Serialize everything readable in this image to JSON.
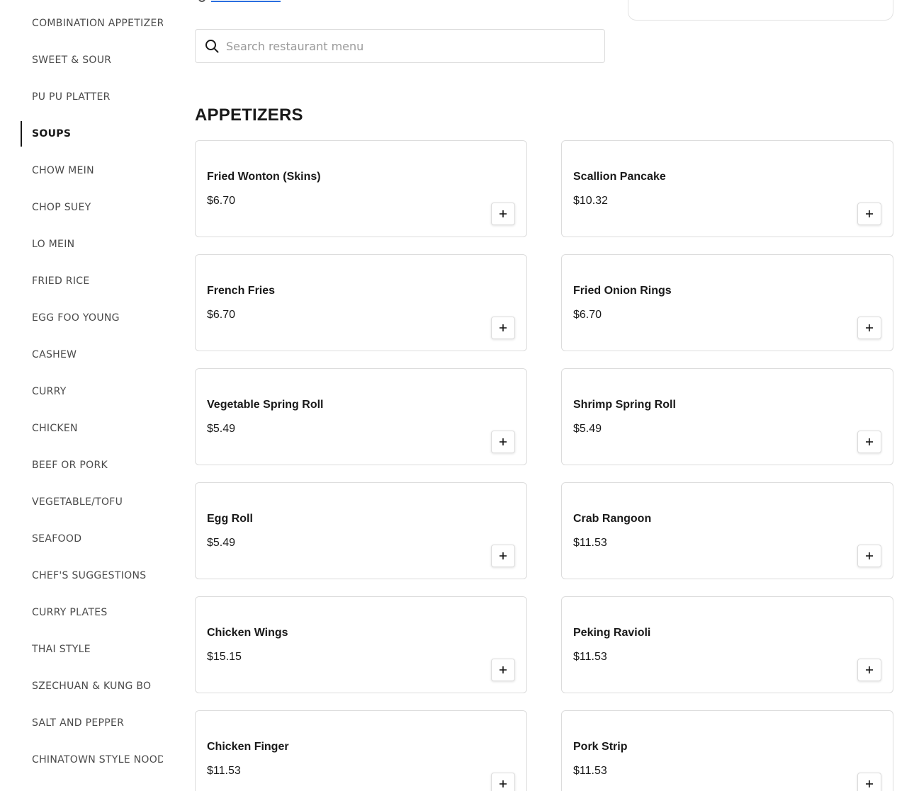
{
  "sidebar": {
    "categories": [
      {
        "label": "COMBINATION APPETIZERS",
        "active": false
      },
      {
        "label": "SWEET & SOUR",
        "active": false
      },
      {
        "label": "PU PU PLATTER",
        "active": false
      },
      {
        "label": "SOUPS",
        "active": true
      },
      {
        "label": "CHOW MEIN",
        "active": false
      },
      {
        "label": "CHOP SUEY",
        "active": false
      },
      {
        "label": "LO MEIN",
        "active": false
      },
      {
        "label": "FRIED RICE",
        "active": false
      },
      {
        "label": "EGG FOO YOUNG",
        "active": false
      },
      {
        "label": "CASHEW",
        "active": false
      },
      {
        "label": "CURRY",
        "active": false
      },
      {
        "label": "CHICKEN",
        "active": false
      },
      {
        "label": "BEEF OR PORK",
        "active": false
      },
      {
        "label": "VEGETABLE/TOFU",
        "active": false
      },
      {
        "label": "SEAFOOD",
        "active": false
      },
      {
        "label": "CHEF'S SUGGESTIONS",
        "active": false
      },
      {
        "label": "CURRY PLATES",
        "active": false
      },
      {
        "label": "THAI STYLE",
        "active": false
      },
      {
        "label": "SZECHUAN & KUNG BO",
        "active": false
      },
      {
        "label": "SALT AND PEPPER",
        "active": false
      },
      {
        "label": "CHINATOWN STYLE NOOD",
        "active": false
      }
    ]
  },
  "search": {
    "placeholder": "Search restaurant menu",
    "value": ""
  },
  "section": {
    "title": "APPETIZERS",
    "items": [
      {
        "name": "Fried Wonton (Skins)",
        "price": "$6.70"
      },
      {
        "name": "Scallion Pancake",
        "price": "$10.32"
      },
      {
        "name": "French Fries",
        "price": "$6.70"
      },
      {
        "name": "Fried Onion Rings",
        "price": "$6.70"
      },
      {
        "name": "Vegetable Spring Roll",
        "price": "$5.49"
      },
      {
        "name": "Shrimp Spring Roll",
        "price": "$5.49"
      },
      {
        "name": "Egg Roll",
        "price": "$5.49"
      },
      {
        "name": "Crab Rangoon",
        "price": "$11.53"
      },
      {
        "name": "Chicken Wings",
        "price": "$15.15"
      },
      {
        "name": "Peking Ravioli",
        "price": "$11.53"
      },
      {
        "name": "Chicken Finger",
        "price": "$11.53"
      },
      {
        "name": "Pork Strip",
        "price": "$11.53"
      }
    ]
  },
  "icons": {
    "search": "search-icon",
    "add": "plus-icon",
    "location": "location-pin-icon"
  },
  "colors": {
    "text": "#191919",
    "muted": "#4a4a4a",
    "border": "#dcdcdc",
    "link": "#2b6fe0"
  }
}
